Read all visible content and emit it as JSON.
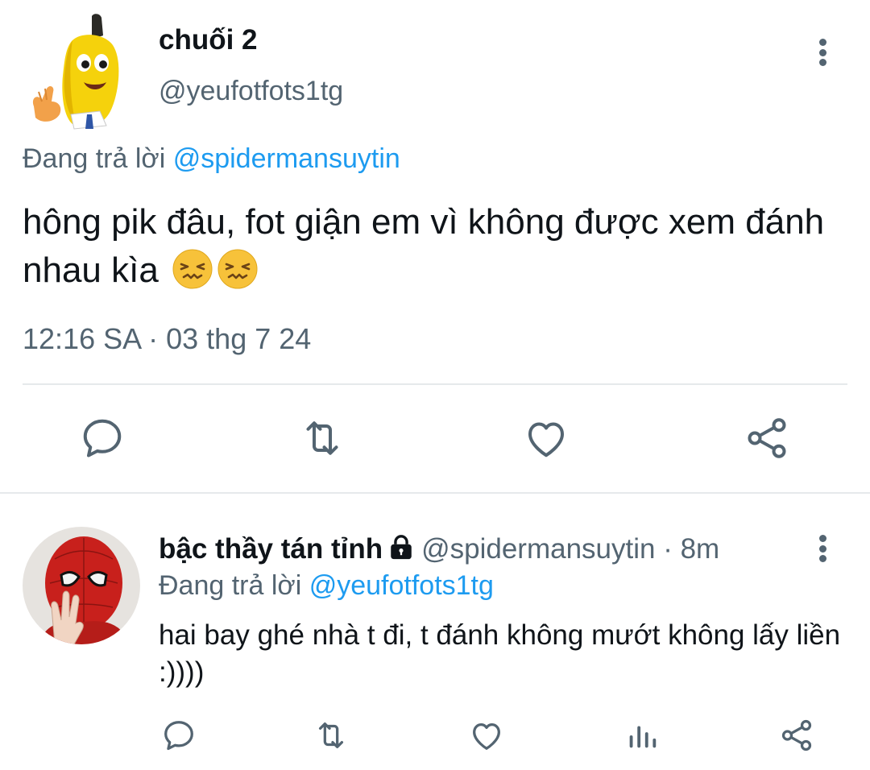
{
  "main_tweet": {
    "author_name": "chuối 2",
    "author_handle": "@yeufotfots1tg",
    "replying_prefix": "Đang trả lời ",
    "replying_to": "@spidermansuytin",
    "text": "hông pik đâu, fot giận em vì không được xem đánh nhau kìa",
    "emoji": [
      "confounded-face",
      "confounded-face"
    ],
    "timestamp": "12:16 SA · 03 thg 7 24",
    "actions": [
      "reply-icon",
      "retweet-icon",
      "like-icon",
      "share-icon"
    ]
  },
  "reply_tweet": {
    "author_name": "bậc thầy tán tỉnh",
    "protected_icon": "lock-icon",
    "author_handle": "@spidermansuytin",
    "separator": " · ",
    "time_ago": "8m",
    "replying_prefix": "Đang trả lời ",
    "replying_to": "@yeufotfots1tg",
    "text": "hai bay ghé nhà t đi, t đánh không mướt không lấy liền :))))",
    "actions": [
      "reply-icon",
      "retweet-icon",
      "like-icon",
      "views-icon",
      "share-icon"
    ]
  },
  "colors": {
    "text_primary": "#0f1419",
    "text_secondary": "#536471",
    "link": "#1d9bf0",
    "divider": "#e6e9eb",
    "emoji_face": "#f7c23a"
  }
}
